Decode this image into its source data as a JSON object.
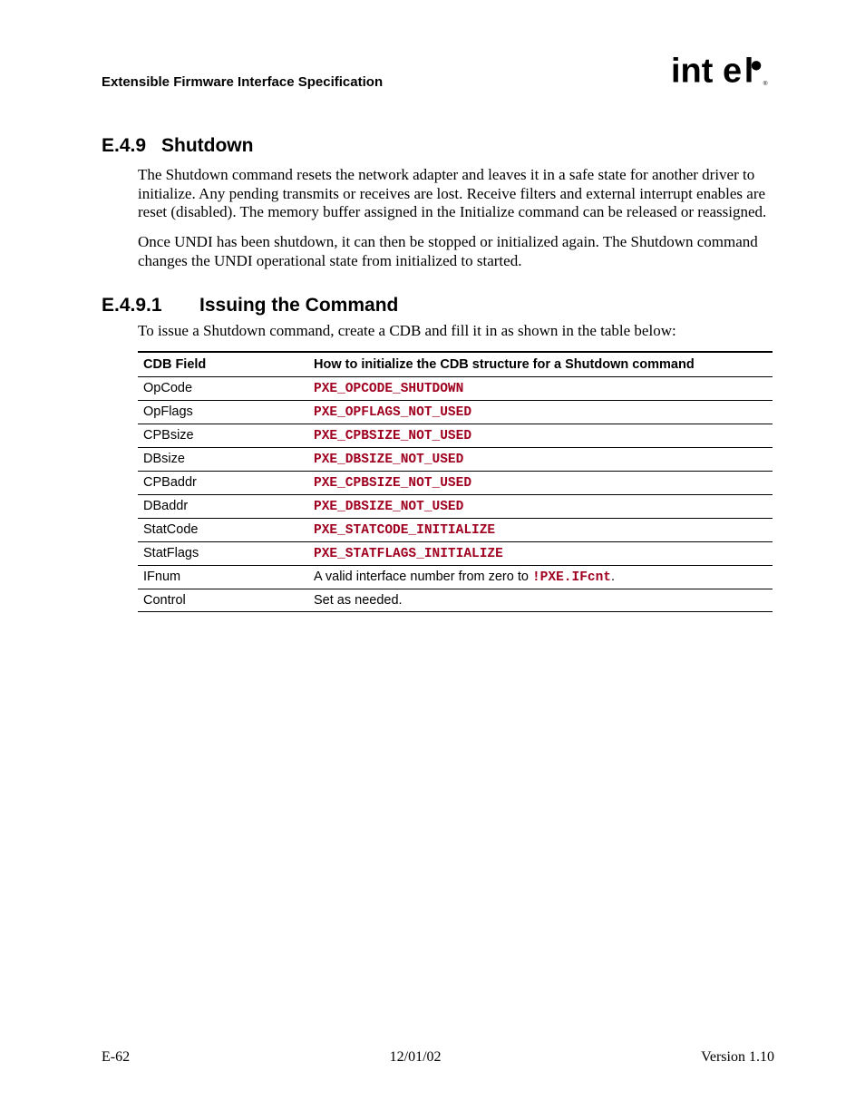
{
  "header": {
    "doc_title": "Extensible Firmware Interface Specification",
    "logo_alt": "intel"
  },
  "section": {
    "number": "E.4.9",
    "title": "Shutdown",
    "para1": "The Shutdown command resets the network adapter and leaves it in a safe state for another driver to initialize.  Any pending transmits or receives are lost.  Receive filters and external interrupt enables are reset (disabled).  The memory buffer assigned in the Initialize command can be released or reassigned.",
    "para2": "Once UNDI has been shutdown, it can then be stopped or initialized again.  The Shutdown command changes the UNDI operational state from initialized to started."
  },
  "subsection": {
    "number": "E.4.9.1",
    "title": "Issuing the Command",
    "intro": "To issue a Shutdown command, create a CDB and fill it in as shown in the table below:"
  },
  "table": {
    "head_field": "CDB Field",
    "head_desc": "How to initialize the CDB structure for a Shutdown command",
    "rows": [
      {
        "field": "OpCode",
        "code": "PXE_OPCODE_SHUTDOWN"
      },
      {
        "field": "OpFlags",
        "code": "PXE_OPFLAGS_NOT_USED"
      },
      {
        "field": "CPBsize",
        "code": "PXE_CPBSIZE_NOT_USED"
      },
      {
        "field": "DBsize",
        "code": "PXE_DBSIZE_NOT_USED"
      },
      {
        "field": "CPBaddr",
        "code": "PXE_CPBSIZE_NOT_USED"
      },
      {
        "field": "DBaddr",
        "code": "PXE_DBSIZE_NOT_USED"
      },
      {
        "field": "StatCode",
        "code": "PXE_STATCODE_INITIALIZE"
      },
      {
        "field": "StatFlags",
        "code": "PXE_STATFLAGS_INITIALIZE"
      },
      {
        "field": "IFnum",
        "text_pre": "A valid interface number from zero to ",
        "code_inline": "!PXE.IFcnt",
        "text_post": "."
      },
      {
        "field": "Control",
        "text": "Set as needed."
      }
    ]
  },
  "footer": {
    "left": "E-62",
    "center": "12/01/02",
    "right": "Version 1.10"
  }
}
